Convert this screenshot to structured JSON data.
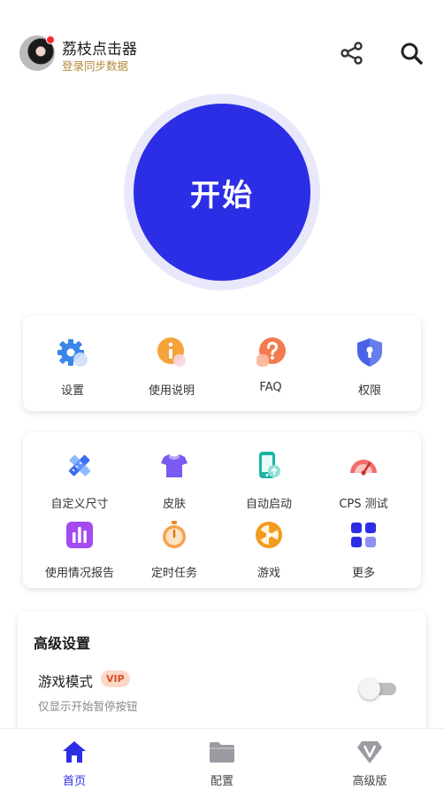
{
  "header": {
    "title": "荔枝点击器",
    "subtitle": "登录同步数据",
    "share_icon": "share-icon",
    "search_icon": "search-icon"
  },
  "start_button": {
    "label": "开始"
  },
  "quick_actions": [
    {
      "label": "设置",
      "icon": "gear-icon"
    },
    {
      "label": "使用说明",
      "icon": "info-icon"
    },
    {
      "label": "FAQ",
      "icon": "question-icon"
    },
    {
      "label": "权限",
      "icon": "shield-icon"
    }
  ],
  "tools": [
    {
      "label": "自定义尺寸",
      "icon": "ruler-pencil-icon"
    },
    {
      "label": "皮肤",
      "icon": "tshirt-icon"
    },
    {
      "label": "自动启动",
      "icon": "phone-icon"
    },
    {
      "label": "CPS 测试",
      "icon": "speedometer-icon"
    },
    {
      "label": "使用情况报告",
      "icon": "bar-chart-icon"
    },
    {
      "label": "定时任务",
      "icon": "stopwatch-icon"
    },
    {
      "label": "游戏",
      "icon": "wheel-icon"
    },
    {
      "label": "更多",
      "icon": "grid-icon"
    }
  ],
  "advanced": {
    "title": "高级设置",
    "game_mode_label": "游戏模式",
    "vip_badge": "VIP",
    "game_mode_desc": "仅显示开始暂停按钮",
    "game_mode_enabled": false
  },
  "bottom_nav": [
    {
      "label": "首页",
      "icon": "home-icon",
      "active": true
    },
    {
      "label": "配置",
      "icon": "folder-icon",
      "active": false
    },
    {
      "label": "高级版",
      "icon": "diamond-v-icon",
      "active": false
    }
  ],
  "colors": {
    "primary": "#2c2ee6",
    "ring": "#e9e8fb",
    "vip_bg": "#fbd8c8",
    "vip_text": "#d5502c"
  }
}
